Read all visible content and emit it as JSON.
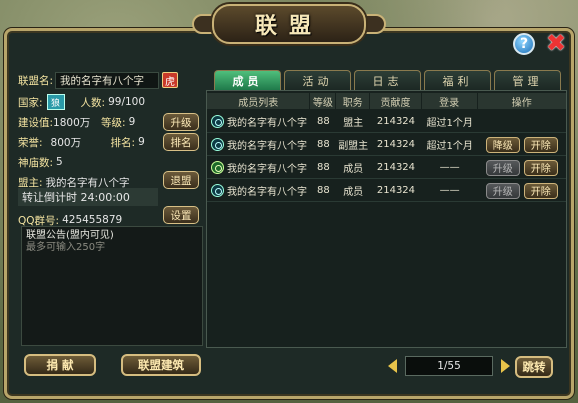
{
  "window": {
    "title": "联盟",
    "help_glyph": "?",
    "close_glyph": "✖"
  },
  "info": {
    "name_label": "联盟名:",
    "name_value": "我的名字有八个字",
    "tiger_glyph": "虎",
    "country_label": "国家:",
    "country_glyph": "狼",
    "members_label": "人数:",
    "members_value": "99/100",
    "construction_label": "建设值:",
    "construction_value": "1800万",
    "level_label": "等级:",
    "level_value": "9",
    "upgrade_btn": "升级",
    "honor_label": "荣誉:",
    "honor_value": "800万",
    "rank_label": "排名:",
    "rank_value": "9",
    "rank_btn": "排名",
    "shrine_label": "神庙数:",
    "shrine_value": "5",
    "leader_label": "盟主:",
    "leader_value": "我的名字有八个字",
    "quit_btn": "退盟",
    "transfer_text": "转让倒计时 24:00:00",
    "qq_label": "QQ群号:",
    "qq_value": "425455879",
    "settings_btn": "设置"
  },
  "notice": {
    "title": "联盟公告(盟内可见)",
    "placeholder": "最多可输入250字"
  },
  "bottom_buttons": {
    "donate": "捐 献",
    "build": "联盟建筑"
  },
  "tabs": [
    {
      "label": "成员",
      "active": true
    },
    {
      "label": "活动"
    },
    {
      "label": "日志"
    },
    {
      "label": "福利"
    },
    {
      "label": "管理"
    }
  ],
  "table": {
    "headers": [
      "成员列表",
      "等级",
      "职务",
      "贡献度",
      "登录",
      "操作"
    ],
    "rows": [
      {
        "name": "我的名字有八个字",
        "level": "88",
        "role": "盟主",
        "contribution": "214324",
        "login": "超过1个月",
        "online": false,
        "actions": []
      },
      {
        "name": "我的名字有八个字",
        "level": "88",
        "role": "副盟主",
        "contribution": "214324",
        "login": "超过1个月",
        "online": false,
        "actions": [
          {
            "label": "降级",
            "enabled": true
          },
          {
            "label": "开除",
            "enabled": true
          }
        ]
      },
      {
        "name": "我的名字有八个字",
        "level": "88",
        "role": "成员",
        "contribution": "214324",
        "login": "——",
        "online": true,
        "actions": [
          {
            "label": "升级",
            "enabled": false
          },
          {
            "label": "开除",
            "enabled": true
          }
        ]
      },
      {
        "name": "我的名字有八个字",
        "level": "88",
        "role": "成员",
        "contribution": "214324",
        "login": "——",
        "online": false,
        "actions": [
          {
            "label": "升级",
            "enabled": false
          },
          {
            "label": "开除",
            "enabled": true
          }
        ]
      }
    ]
  },
  "pager": {
    "text": "1/55",
    "jump_btn": "跳转"
  }
}
